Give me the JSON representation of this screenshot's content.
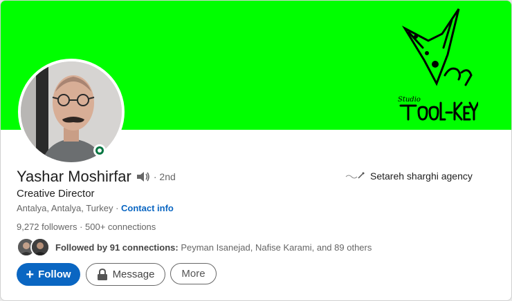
{
  "banner": {
    "color": "#00ff00",
    "logo_text_1": "Studio",
    "logo_text_2": "Tool-KEY"
  },
  "profile": {
    "name": "Yashar Moshirfar",
    "degree": "· 2nd",
    "headline": "Creative Director",
    "location": "Antalya, Antalya, Turkey",
    "separator": " · ",
    "contact_info": "Contact info",
    "followers": "9,272 followers",
    "connections": "500+ connections",
    "stats_sep": " · ",
    "presence": "online"
  },
  "followed_by": {
    "lead": "Followed by 91 connections:",
    "names": " Peyman Isanejad, Nafise Karami, and 89 others"
  },
  "actions": {
    "follow": "Follow",
    "message": "Message",
    "more": "More"
  },
  "experience": {
    "company": "Setareh sharghi agency"
  },
  "colors": {
    "primary": "#0a66c2",
    "online": "#057642"
  }
}
